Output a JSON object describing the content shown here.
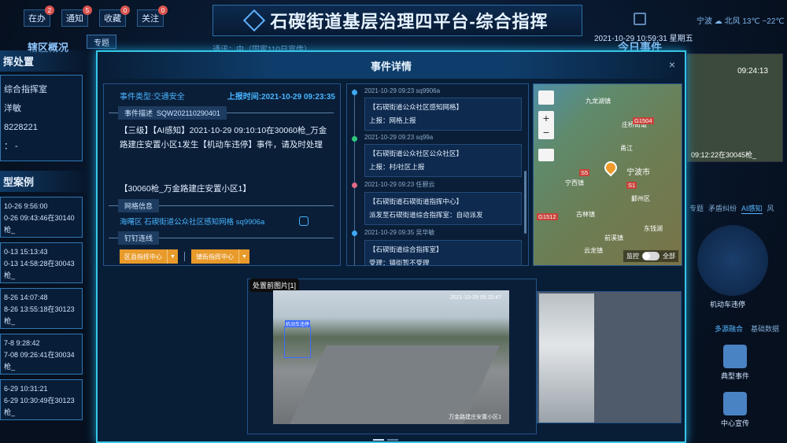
{
  "header": {
    "title": "石碶街道基层治理四平台-综合指挥",
    "buttons": [
      {
        "label": "在办",
        "badge": "2"
      },
      {
        "label": "通知",
        "badge": "5"
      },
      {
        "label": "收藏",
        "badge": "0"
      },
      {
        "label": "关注",
        "badge": "0"
      }
    ],
    "weather": "宁波 ☁ 北风 13℃ ~22℃",
    "datetime": "2021-10-29 10:59:31 星期五",
    "left_section": "辖区概况",
    "special_btn": "专题",
    "right_section": "今日事件",
    "notice": "通讯：中（国家110日宣传）"
  },
  "left_panel": {
    "command_title": "挥处置",
    "command_lines": [
      "综合指挥室",
      "洋敏",
      "8228221",
      "： -"
    ],
    "case_title": "型案例",
    "cases": [
      {
        "line1": "10-26 9:56:00",
        "line2": "0-26 09:43:46在30140枪_"
      },
      {
        "line1": "0-13 15:13:43",
        "line2": "0-13 14:58:28在30043枪_"
      },
      {
        "line1": "8-26 14:07:48",
        "line2": "8-26 13:55:18在30123枪_"
      },
      {
        "line1": "7-8 9:28:42",
        "line2": "7-08 09:26:41在30034枪_"
      },
      {
        "line1": "6-29 10:31:21",
        "line2": "6-29 10:30:49在30123枪_"
      }
    ]
  },
  "right_panel": {
    "cam_time": "09:24:13",
    "cam_caption": "09:12:22在30045枪_",
    "tabs": [
      "专题",
      "矛盾纠纷",
      "AI感知",
      "风"
    ],
    "active_tab": "AI感知",
    "circle_label": "机动车违停",
    "tabs2": [
      "多源融合",
      "基础数据"
    ],
    "icons": [
      {
        "label": "典型事件",
        "icon": "clipboard-icon"
      },
      {
        "label": "中心宣传",
        "icon": "grid-icon"
      }
    ]
  },
  "modal": {
    "title": "事件详情",
    "close": "×",
    "event_type": "事件类型:交通安全",
    "report_time": "上报时间:2021-10-29 09:23:35",
    "desc_label": "事件描述",
    "event_no": "SQW202110290401",
    "description": "【三级】【AI感知】2021-10-29 09:10:10在30060枪_万金路建庄安置小区1发生【机动车违停】事件，请及时处理",
    "location": "【30060枪_万金路建庄安置小区1】",
    "grid_label": "网格信息",
    "grid_value": "海曙区 石碶街道公众社区感知网格 sq9906a",
    "ding_label": "钉钉连线",
    "org1": "区县指挥中心",
    "org2": "镇街指挥中心",
    "timeline": [
      {
        "time": "2021-10-29 09:23 sq9906a",
        "title": "【石碶街道公众社区感知网格】",
        "detail": "上报：网格上报",
        "color": "#3fa9f5"
      },
      {
        "time": "2021-10-29 09:23 sq99a",
        "title": "【石碶街道公众社区公众社区】",
        "detail": "上报：村/社区上报",
        "color": "#2fc77c"
      },
      {
        "time": "2021-10-29 09:23 任碧云",
        "title": "【石碶街道石碶街道指挥中心】",
        "detail": "派发至石碶街道综合指挥室：自动派发",
        "color": "#e06a88"
      },
      {
        "time": "2021-10-29 09:35 吴华敏",
        "title": "【石碶街道综合指挥室】",
        "detail": "受理：镇街暂不受理",
        "color": "#3fa9f5"
      }
    ],
    "map": {
      "places": [
        "九龙湖镇",
        "庄桥街道",
        "宁波市",
        "鄞州区",
        "东钱湖",
        "宁西镇",
        "古林镇",
        "前溪镇",
        "甬江",
        "云龙镇"
      ],
      "highways": [
        "G1504",
        "S5",
        "S1",
        "G1512"
      ],
      "monitor": "监控",
      "full": "全部"
    },
    "photo_label": "处置前图片[1]",
    "photo_ts": "2021-10-29 09:20:47",
    "photo_wm": "万金路建庄安置小区1",
    "detect_label": "机动车违停"
  }
}
